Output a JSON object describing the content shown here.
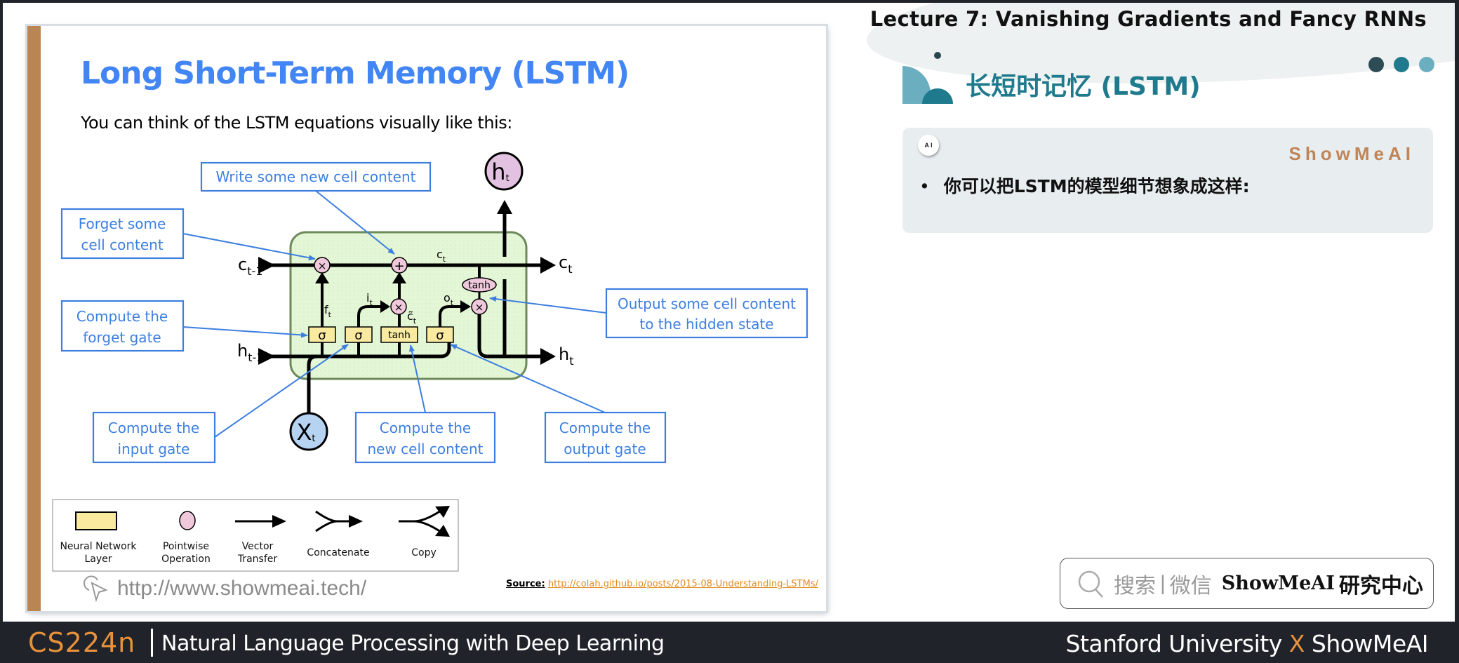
{
  "slide": {
    "title": "Long Short-Term Memory (LSTM)",
    "subtitle": "You can think of the LSTM equations visually like this:",
    "diagram": {
      "node_labels": {
        "c_prev": "c",
        "c_prev_sub": "t-1",
        "h_prev": "h",
        "h_prev_sub": "t-1",
        "c_out": "c",
        "c_out_sub": "t",
        "h_out": "h",
        "h_out_sub": "t",
        "c_mid": "c",
        "c_mid_sub": "t",
        "f": "f",
        "f_sub": "t",
        "i": "i",
        "i_sub": "t",
        "o": "o",
        "o_sub": "t",
        "ctilde": "c̃",
        "ctilde_sub": "t",
        "x_input": "X",
        "x_input_sub": "t",
        "h_top": "h",
        "h_top_sub": "t",
        "multiply": "×",
        "add": "+",
        "sigma": "σ",
        "tanh": "tanh"
      },
      "callouts": {
        "write_new": "Write some new cell content",
        "forget_some_1": "Forget some",
        "forget_some_2": "cell content",
        "forget_gate_1": "Compute the",
        "forget_gate_2": "forget gate",
        "input_gate_1": "Compute the",
        "input_gate_2": "input gate",
        "new_cell_1": "Compute the",
        "new_cell_2": "new cell content",
        "output_gate_1": "Compute the",
        "output_gate_2": "output gate",
        "output_hidden_1": "Output some cell content",
        "output_hidden_2": "to the hidden state"
      },
      "legend": [
        {
          "label1": "Neural Network",
          "label2": "Layer",
          "icon": "yellow-rect"
        },
        {
          "label1": "Pointwise",
          "label2": "Operation",
          "icon": "pink-circle"
        },
        {
          "label1": "Vector",
          "label2": "Transfer",
          "icon": "arrow"
        },
        {
          "label1": "Concatenate",
          "label2": "",
          "icon": "merge-arrow"
        },
        {
          "label1": "Copy",
          "label2": "",
          "icon": "split-arrow"
        }
      ]
    },
    "source_label": "Source:",
    "source_url": "http://colah.github.io/posts/2015-08-Understanding-LSTMs/",
    "watermark": "http://www.showmeai.tech/"
  },
  "right_panel": {
    "lecture_title": "Lecture 7: Vanishing Gradients and Fancy RNNs",
    "section_title": "长短时记忆 (LSTM)",
    "card": {
      "badge": "A I",
      "brand": "ShowMeAI",
      "bullet": "你可以把LSTM的模型细节想象成这样:"
    },
    "search": {
      "icon": "search-icon",
      "text1": "搜索",
      "separator": "|",
      "text2": "微信",
      "name": "ShowMeAI",
      "suffix": "研究中心"
    }
  },
  "footer": {
    "course": "CS224n",
    "description": "Natural Language Processing with Deep Learning",
    "right_1": "Stanford University",
    "right_x": "X",
    "right_2": "ShowMeAI"
  },
  "colors": {
    "accent_blue": "#4285f4",
    "callout_blue": "#3d7fe0",
    "teal": "#1e7a8c",
    "orange": "#e8913a",
    "brand_brown": "#c08457",
    "footer_bg": "#20242a",
    "cell_green": "#e3f6d5",
    "layer_yellow": "#f9eaa0",
    "op_pink": "#f0c8dc",
    "input_blue": "#b6d3f2"
  }
}
